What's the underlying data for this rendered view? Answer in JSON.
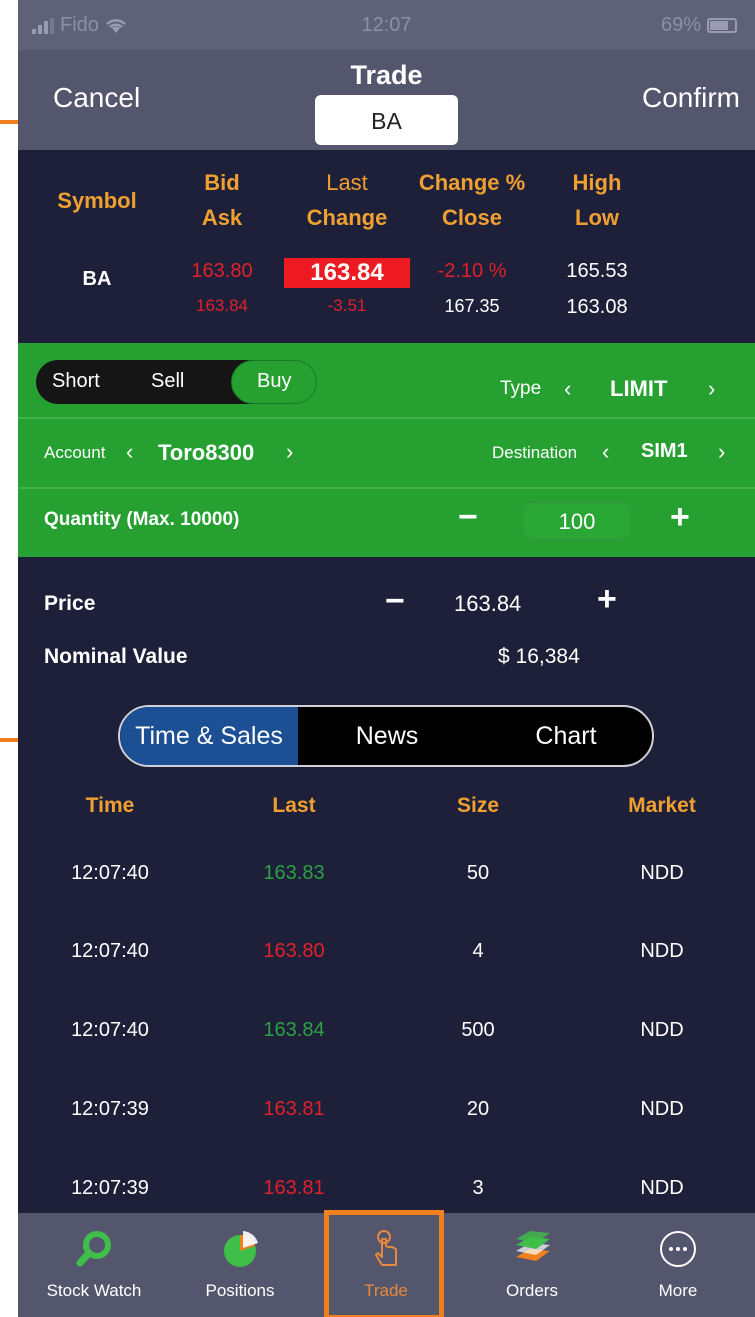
{
  "status": {
    "carrier": "Fido",
    "time": "12:07",
    "battery": "69%"
  },
  "header": {
    "cancel": "Cancel",
    "title": "Trade",
    "symbol": "BA",
    "confirm": "Confirm"
  },
  "quote": {
    "headers": {
      "symbol": "Symbol",
      "bid": "Bid",
      "ask": "Ask",
      "last": "Last",
      "change": "Change",
      "change_pct": "Change %",
      "close": "Close",
      "high": "High",
      "low": "Low"
    },
    "symbol": "BA",
    "bid": "163.80",
    "ask": "163.84",
    "last": "163.84",
    "change": "-3.51",
    "change_pct": "-2.10 %",
    "close": "167.35",
    "high": "165.53",
    "low": "163.08"
  },
  "order": {
    "sides": [
      "Short",
      "Sell",
      "Buy"
    ],
    "selected_side": "Buy",
    "type_label": "Type",
    "type_value": "LIMIT",
    "account_label": "Account",
    "account_value": "Toro8300",
    "destination_label": "Destination",
    "destination_value": "SIM1",
    "quantity_label": "Quantity (Max. 10000)",
    "quantity_value": "100",
    "price_label": "Price",
    "price_value": "163.84",
    "nominal_label": "Nominal Value",
    "nominal_value": "$ 16,384"
  },
  "tabs": [
    "Time & Sales",
    "News",
    "Chart"
  ],
  "active_tab": "Time & Sales",
  "time_sales": {
    "headers": [
      "Time",
      "Last",
      "Size",
      "Market"
    ],
    "rows": [
      {
        "time": "12:07:40",
        "last": "163.83",
        "size": "50",
        "market": "NDD"
      },
      {
        "time": "12:07:40",
        "last": "163.80",
        "size": "4",
        "market": "NDD"
      },
      {
        "time": "12:07:40",
        "last": "163.84",
        "size": "500",
        "market": "NDD"
      },
      {
        "time": "12:07:39",
        "last": "163.81",
        "size": "20",
        "market": "NDD"
      },
      {
        "time": "12:07:39",
        "last": "163.81",
        "size": "3",
        "market": "NDD"
      }
    ]
  },
  "nav": [
    {
      "label": "Stock Watch",
      "icon": "magnifier-icon"
    },
    {
      "label": "Positions",
      "icon": "pie-chart-icon"
    },
    {
      "label": "Trade",
      "icon": "tap-hand-icon"
    },
    {
      "label": "Orders",
      "icon": "stacked-layers-icon"
    },
    {
      "label": "More",
      "icon": "more-dots-icon"
    }
  ],
  "colors": {
    "accent": "#f07f1e",
    "positive": "#2aa244",
    "negative": "#e0202a",
    "panel_green": "#27a032",
    "background": "#1e2039"
  }
}
